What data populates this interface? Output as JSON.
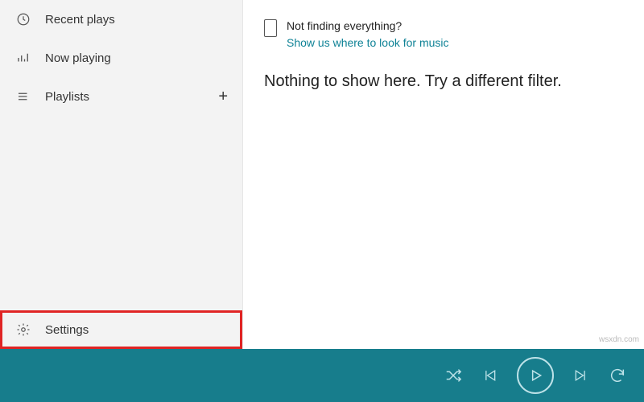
{
  "sidebar": {
    "recent": "Recent plays",
    "now_playing": "Now playing",
    "playlists": "Playlists",
    "settings": "Settings"
  },
  "hint": {
    "title": "Not finding everything?",
    "link": "Show us where to look for music"
  },
  "empty_state": "Nothing to show here. Try a different filter.",
  "watermark": "wsxdn.com"
}
